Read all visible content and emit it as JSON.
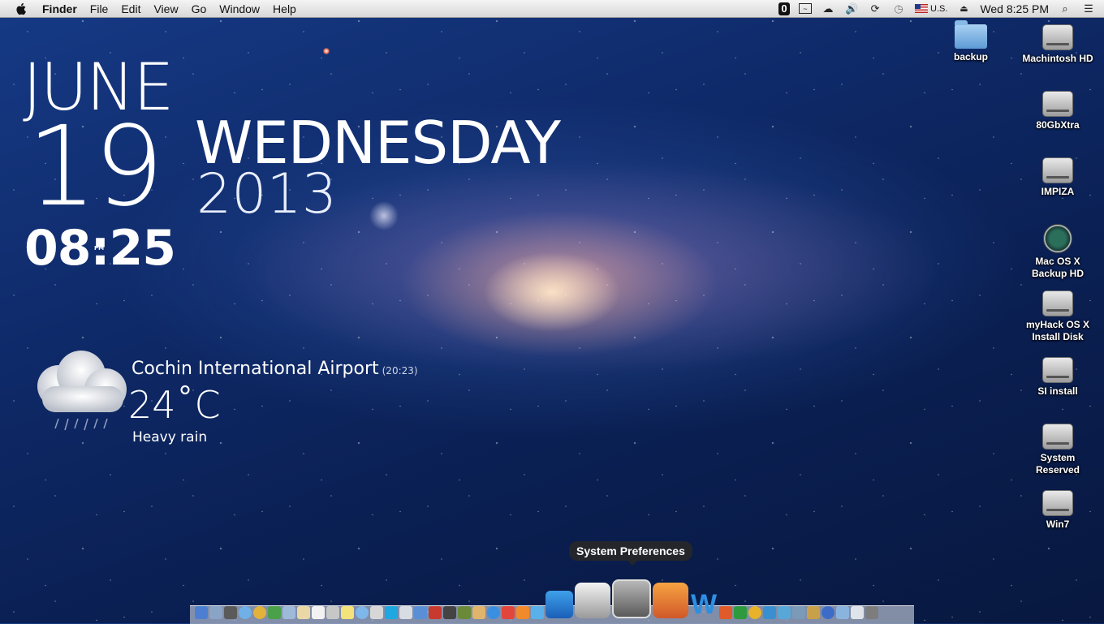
{
  "menubar": {
    "app_name": "Finder",
    "menus": [
      "File",
      "Edit",
      "View",
      "Go",
      "Window",
      "Help"
    ],
    "input_source": "U.S.",
    "clock": "Wed 8:25 PM",
    "status_icons": [
      "onepassword-icon",
      "activity-monitor-icon",
      "icloud-icon",
      "volume-icon",
      "sync-icon",
      "time-machine-icon",
      "flag-icon",
      "eject-icon",
      "spotlight-icon",
      "notification-center-icon"
    ]
  },
  "clock_widget": {
    "month": "JUNE",
    "day": "19",
    "weekday": "WEDNESDAY",
    "year": "2013",
    "time": "08:25",
    "ampm": "PM"
  },
  "weather": {
    "location": "Cochin International Airport",
    "observed": "(20:23)",
    "temperature": "24˚C",
    "condition": "Heavy rain",
    "icon": "rain-cloud-icon"
  },
  "desktop": {
    "items": [
      {
        "label": "backup",
        "kind": "folder"
      },
      {
        "label": "Machintosh HD",
        "kind": "hdd"
      },
      {
        "label": "80GbXtra",
        "kind": "hdd"
      },
      {
        "label": "IMPIZA",
        "kind": "hdd"
      },
      {
        "label": "Mac OS X Backup HD",
        "kind": "timemachine"
      },
      {
        "label": "myHack OS X Install Disk",
        "kind": "hdd"
      },
      {
        "label": "SI install",
        "kind": "hdd"
      },
      {
        "label": "System Reserved",
        "kind": "hdd"
      },
      {
        "label": "Win7",
        "kind": "hdd"
      }
    ]
  },
  "dock": {
    "tooltip": "System Preferences"
  },
  "colors": {
    "menubar_bg": "#e4e4e4",
    "desktop_bg": "#0f2a69",
    "galaxy_core": "#ffe6c8"
  }
}
